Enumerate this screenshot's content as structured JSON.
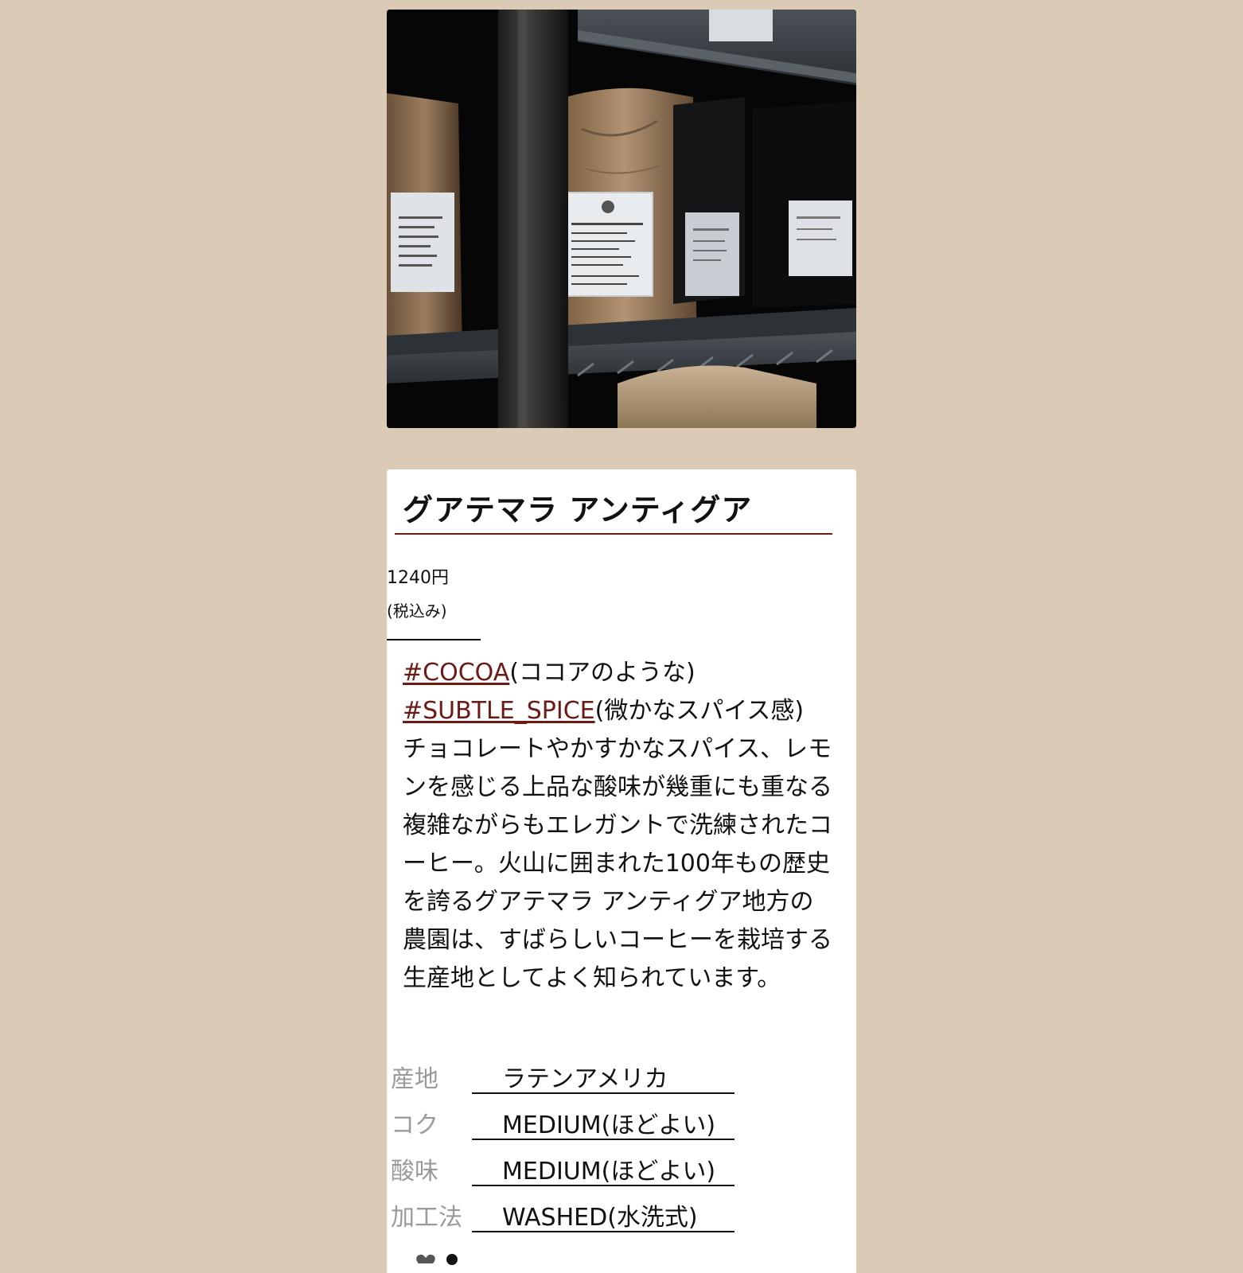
{
  "product": {
    "image_alt": "coffee bean bags on shelf",
    "title": "グアテマラ アンティグア",
    "price": "1240円",
    "tax_note": "(税込み)",
    "tags": [
      {
        "tag": "#COCOA",
        "meaning": "(ココアのような)"
      },
      {
        "tag": "#SUBTLE_SPICE",
        "meaning": "(微かなスパイス感)"
      }
    ],
    "description": "チョコレートやかすかなスパイス、レモンを感じる上品な酸味が幾重にも重なる複雑ながらもエレガントで洗練されたコーヒー。火山に囲まれた100年もの歴史を誇るグアテマラ アンティグア地方の農園は、すばらしいコーヒーを栽培する生産地としてよく知られています。",
    "specs": [
      {
        "label": "産地",
        "value": "ラテンアメリカ"
      },
      {
        "label": "コク",
        "value": "MEDIUM(ほどよい)"
      },
      {
        "label": "酸味",
        "value": "MEDIUM(ほどよい)"
      },
      {
        "label": "加工法",
        "value": "WASHED(水洗式)"
      }
    ]
  },
  "icons": {
    "bottom": "heart-icon"
  },
  "colors": {
    "background": "#dbcab6",
    "card": "#ffffff",
    "accent": "#6b1a16",
    "muted_label": "#9a9a9a"
  }
}
